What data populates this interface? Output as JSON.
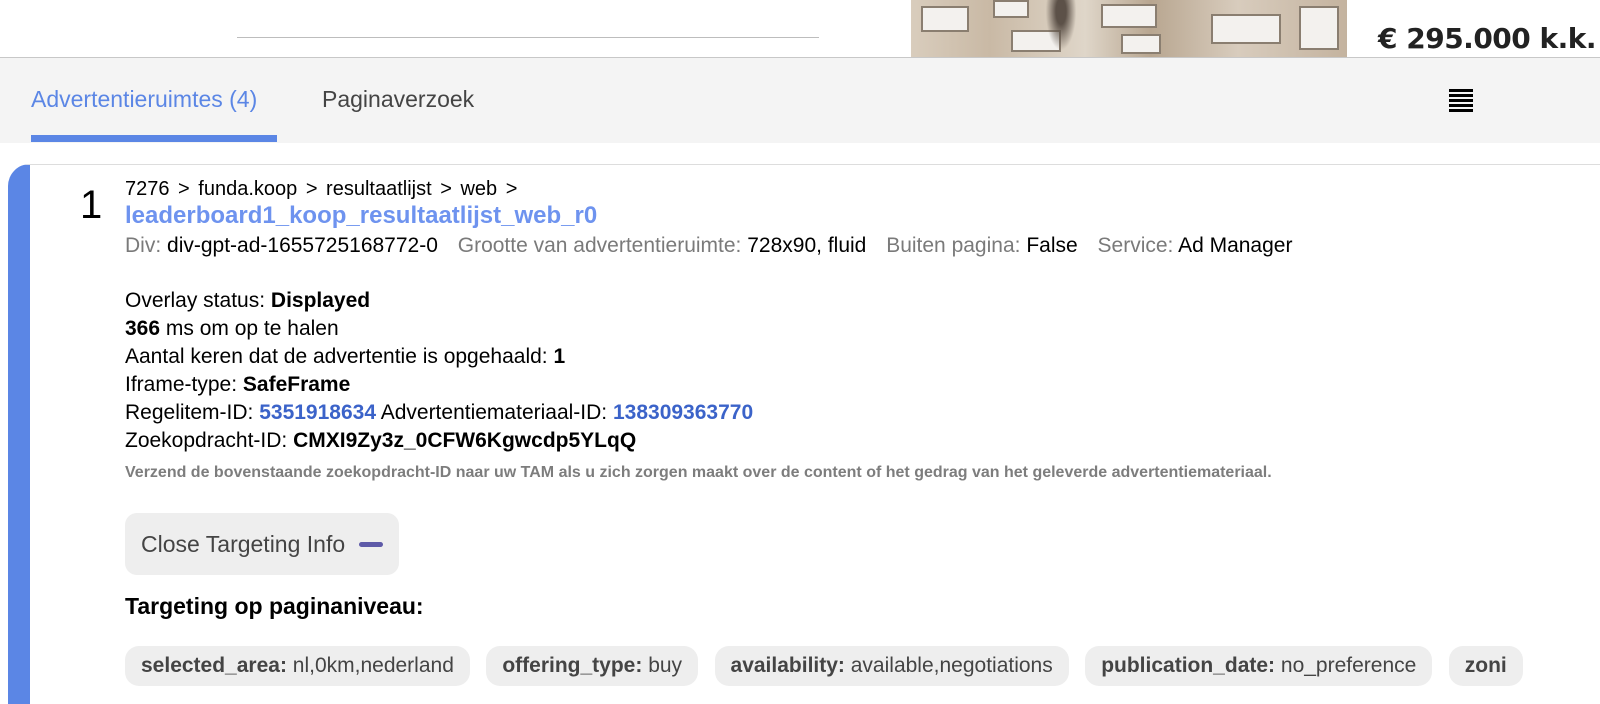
{
  "listing": {
    "price": "€ 295.000 k.k."
  },
  "tabs": [
    {
      "label": "Advertentieruimtes (4)",
      "active": true
    },
    {
      "label": "Paginaverzoek",
      "active": false
    }
  ],
  "slot": {
    "index": "1",
    "breadcrumb": "7276 >  funda.koop >  resultaatlijst >  web >",
    "ad_unit": "leaderboard1_koop_resultaatlijst_web_r0",
    "meta": [
      {
        "key": "Div:",
        "value": "div-gpt-ad-1655725168772-0"
      },
      {
        "key": "Grootte van advertentieruimte:",
        "value": "728x90, fluid"
      },
      {
        "key": "Buiten pagina:",
        "value": "False"
      },
      {
        "key": "Service:",
        "value": "Ad Manager"
      }
    ],
    "overlay_label": "Overlay status:",
    "overlay_value": "Displayed",
    "fetch_ms": "366",
    "fetch_label": "ms om op te halen",
    "fetch_count_label": "Aantal keren dat de advertentie is opgehaald:",
    "fetch_count": "1",
    "iframe_label": "Iframe-type:",
    "iframe_value": "SafeFrame",
    "line_item_label": "Regelitem-ID:",
    "line_item_id": "5351918634",
    "creative_label": "Advertentiemateriaal-ID:",
    "creative_id": "138309363770",
    "query_label": "Zoekopdracht-ID:",
    "query_id": "CMXI9Zy3z_0CFW6Kgwcdp5YLqQ",
    "note": "Verzend de bovenstaande zoekopdracht-ID naar uw TAM als u zich zorgen maakt over de content of het gedrag van het geleverde advertentiemateriaal.",
    "toggle_label": "Close Targeting Info",
    "targeting_heading": "Targeting op paginaniveau:",
    "targeting": [
      {
        "key": "selected_area:",
        "value": "nl,0km,nederland"
      },
      {
        "key": "offering_type:",
        "value": "buy"
      },
      {
        "key": "availability:",
        "value": "available,negotiations"
      },
      {
        "key": "publication_date:",
        "value": "no_preference"
      },
      {
        "key": "zoni",
        "value": ""
      }
    ]
  },
  "colors": {
    "accent": "#5b86e5",
    "link": "#3b63c9",
    "ad_name": "#6e93ef"
  }
}
